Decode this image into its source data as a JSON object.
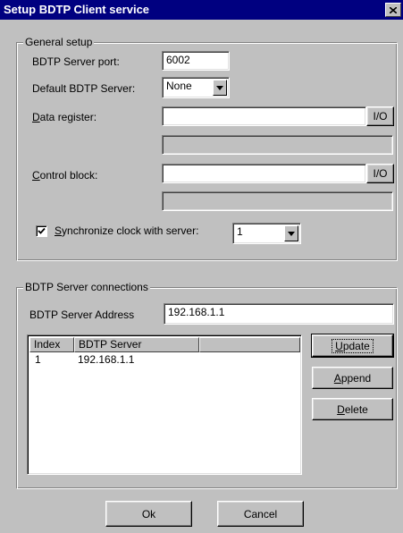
{
  "window": {
    "title": "Setup BDTP Client service"
  },
  "general": {
    "group_label": "General setup",
    "server_port_label": "BDTP Server port:",
    "server_port_value": "6002",
    "default_server_label": "Default BDTP Server:",
    "default_server_value": "None",
    "data_register_label_u": "D",
    "data_register_label_rest": "ata register:",
    "data_register_value": "",
    "data_register_io": "I/O",
    "control_block_label_u": "C",
    "control_block_label_rest": "ontrol block:",
    "control_block_value": "",
    "control_block_io": "I/O",
    "sync_checked": true,
    "sync_label_u": "S",
    "sync_label_rest": "ynchronize clock with server:",
    "sync_value": "1"
  },
  "connections": {
    "group_label": "BDTP Server connections",
    "address_label": "BDTP Server Address",
    "address_value": "192.168.1.1",
    "columns": [
      "Index",
      "BDTP Server",
      ""
    ],
    "rows": [
      {
        "index": "1",
        "server": "192.168.1.1"
      }
    ],
    "update_u": "U",
    "update_rest": "pdate",
    "append_u": "A",
    "append_rest": "ppend",
    "delete_u": "D",
    "delete_rest": "elete"
  },
  "footer": {
    "ok_label": "Ok",
    "cancel_label": "Cancel"
  }
}
